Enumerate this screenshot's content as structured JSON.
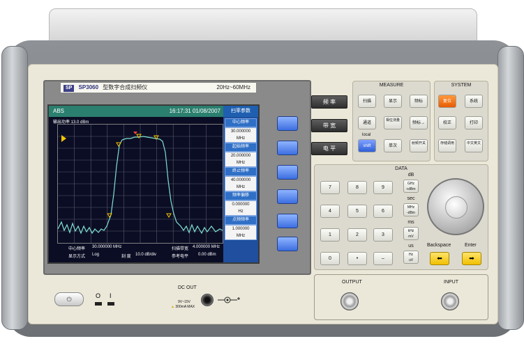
{
  "brand": {
    "logo": "SP",
    "model": "SP3060",
    "desc": "型数字合成扫频仪",
    "range": "20Hz~60MHz"
  },
  "screen": {
    "mode": "ABS",
    "time": "16:17:31 01/08/2007",
    "menu_title": "扫率参数",
    "ref_level": "输出功率  13.0 dBm",
    "soft_items": [
      {
        "title": "中心频率",
        "value": "30.000000",
        "unit": "MHz"
      },
      {
        "title": "起始频率",
        "value": "20.000000",
        "unit": "MHz"
      },
      {
        "title": "终止频率",
        "value": "40.000000",
        "unit": "MHz"
      },
      {
        "title": "频率偏移",
        "value": "0.000000",
        "unit": "Hz"
      },
      {
        "title": "点频频率",
        "value": "1.000000",
        "unit": "MHz"
      }
    ],
    "bottom": {
      "center_label": "中心频率",
      "center_value": "30.000000 MHz",
      "span_label": "扫描带宽",
      "span_value": "4.000000 MHz",
      "disp_label": "显示方式",
      "disp_value": "Log",
      "scale_label": "刻  度",
      "scale_value": "10.0 dB/div",
      "ref_label": "参考电平",
      "ref_value": "0.00 dBm"
    }
  },
  "left_keys": [
    "频 率",
    "带 宽",
    "电 平"
  ],
  "measure": {
    "title": "MEASURE",
    "keys": [
      "扫描",
      "显示",
      "频标",
      "通道",
      "相位测量",
      "频标→",
      "",
      "单次",
      "射频开关"
    ],
    "local_label": "local",
    "shift_label": "shift"
  },
  "system": {
    "title": "SYSTEM",
    "keys": [
      "复位",
      "系统",
      "校正",
      "打印",
      "存储调用",
      "中文英文"
    ]
  },
  "data": {
    "title": "DATA",
    "numkeys": [
      "7",
      "8",
      "9",
      "4",
      "5",
      "6",
      "1",
      "2",
      "3",
      "0",
      "•",
      "–"
    ],
    "unit_labels": [
      "dB",
      "sec",
      "ms",
      "us"
    ],
    "unit_keys": [
      "GHz\n+dBm",
      "MHz\n-dBm",
      "kHz\nmV",
      "Hz\nuV"
    ],
    "backspace_label": "Backspace",
    "enter_label": "Enter",
    "backspace_glyph": "⬅",
    "enter_glyph": "➡"
  },
  "io": {
    "output": "OUTPUT",
    "input": "INPUT"
  },
  "dc": {
    "title": "DC OUT",
    "spec1": "9V~15V",
    "spec2": "300mA MAX"
  },
  "power": {
    "glyph": "⏻",
    "on": "I",
    "off": "O"
  },
  "colors": {
    "screen_bg": "#0b0d24",
    "trace": "#7ee0d2",
    "marker": "#f4c400",
    "menu_blue": "#1f5fb0",
    "panel": "#ebe8d9"
  }
}
